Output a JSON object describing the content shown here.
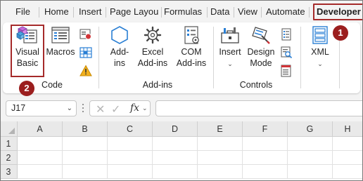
{
  "tabs": [
    "File",
    "Home",
    "Insert",
    "Page Layou",
    "Formulas",
    "Data",
    "View",
    "Automate",
    "Developer"
  ],
  "callouts": [
    "1",
    "2"
  ],
  "ribbon": {
    "visual_basic": "Visual Basic",
    "macros": "Macros",
    "addins": "Add-ins",
    "excel_addins": "Excel Add-ins",
    "com_addins": "COM Add-ins",
    "insert": "Insert",
    "design_mode": "Design Mode",
    "xml": "XML",
    "groups": [
      "Code",
      "Add-ins",
      "Controls"
    ]
  },
  "formula_bar": {
    "name_box": "J17",
    "fx": "fx",
    "value": ""
  },
  "grid": {
    "columns": [
      "A",
      "B",
      "C",
      "D",
      "E",
      "F",
      "G",
      "H"
    ],
    "rows": [
      "1",
      "2",
      "3"
    ]
  },
  "colors": {
    "highlight": "#a52a2a",
    "callout": "#9b1e1e",
    "excel_green": "#217346"
  }
}
